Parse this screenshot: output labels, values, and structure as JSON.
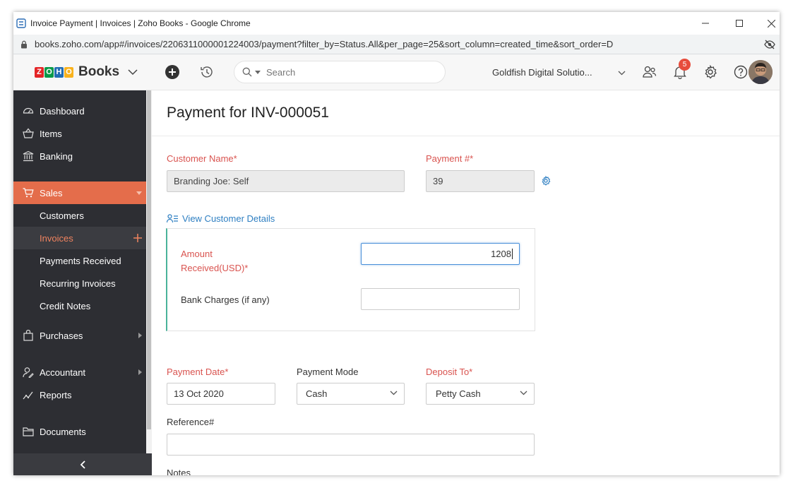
{
  "browser": {
    "window_title": "Invoice Payment | Invoices | Zoho Books - Google Chrome",
    "url": "books.zoho.com/app#/invoices/2206311000001224003/payment?filter_by=Status.All&per_page=25&sort_column=created_time&sort_order=D"
  },
  "app": {
    "logo_letters": [
      "Z",
      "O",
      "H",
      "O"
    ],
    "logo_colors": [
      "#e42527",
      "#089949",
      "#226db4",
      "#f9b21d"
    ],
    "product_name": "Books",
    "search_placeholder": "Search",
    "org_name": "Goldfish Digital Solutio...",
    "notification_count": "5"
  },
  "sidebar": {
    "items": [
      {
        "label": "Dashboard",
        "icon": "dashboard-icon"
      },
      {
        "label": "Items",
        "icon": "basket-icon"
      },
      {
        "label": "Banking",
        "icon": "bank-icon"
      },
      {
        "label": "Sales",
        "icon": "cart-icon"
      },
      {
        "label": "Customers"
      },
      {
        "label": "Invoices"
      },
      {
        "label": "Payments Received"
      },
      {
        "label": "Recurring Invoices"
      },
      {
        "label": "Credit Notes"
      },
      {
        "label": "Purchases",
        "icon": "bag-icon"
      },
      {
        "label": "Accountant",
        "icon": "accountant-icon"
      },
      {
        "label": "Reports",
        "icon": "reports-icon"
      },
      {
        "label": "Documents",
        "icon": "folder-icon"
      }
    ],
    "active_color": "#e46d4b"
  },
  "form": {
    "page_title": "Payment for INV-000051",
    "customer_name_label": "Customer Name*",
    "customer_name_value": "Branding Joe: Self",
    "payment_no_label": "Payment #*",
    "payment_no_value": "39",
    "view_customer_details": "View Customer Details",
    "amount_label_line1": "Amount",
    "amount_label_line2": "Received(USD)*",
    "amount_value": "1208",
    "bank_charges_label": "Bank Charges (if any)",
    "bank_charges_value": "",
    "payment_date_label": "Payment Date*",
    "payment_date_value": "13 Oct 2020",
    "payment_mode_label": "Payment Mode",
    "payment_mode_value": "Cash",
    "deposit_to_label": "Deposit To*",
    "deposit_to_value": "Petty Cash",
    "reference_label": "Reference#",
    "reference_value": "",
    "notes_label": "Notes"
  }
}
